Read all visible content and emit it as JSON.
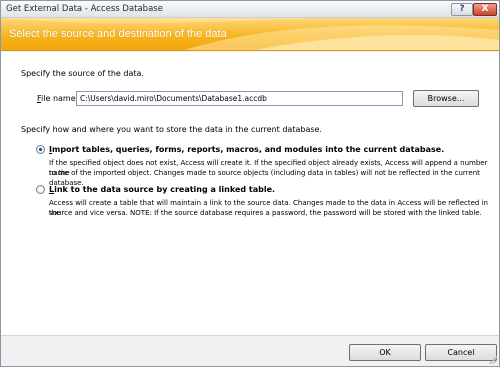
{
  "window": {
    "title": "Get External Data - Access Database",
    "help_glyph": "?",
    "close_glyph": "X"
  },
  "banner": {
    "heading": "Select the source and destination of the data"
  },
  "source": {
    "prompt": "Specify the source of the data.",
    "file_label_accel": "F",
    "file_label_rest": "ile name:",
    "file_value": "C:\\Users\\david.miro\\Documents\\Database1.accdb",
    "browse_label": "Browse..."
  },
  "storage": {
    "prompt": "Specify how and where you want to store the data in the current database.",
    "options": [
      {
        "accel": "I",
        "title_rest": "mport tables, queries, forms, reports, macros, and modules into the current database.",
        "selected": true,
        "desc_line1": "If the specified object does not exist, Access will create it. If the specified object already exists, Access will append a number to the",
        "desc_line2": "name of the imported object. Changes made to source objects (including data in tables) will not be reflected in the current database."
      },
      {
        "accel": "L",
        "title_rest": "ink to the data source by creating a linked table.",
        "selected": false,
        "desc_line1": "Access will create a table that will maintain a link to the source data. Changes made to the data in Access will be reflected in the",
        "desc_line2": "source and vice versa. NOTE:  If the source database requires a password, the password will be stored with the linked table."
      }
    ]
  },
  "footer": {
    "ok_label": "OK",
    "cancel_label": "Cancel"
  },
  "colors": {
    "banner": "#f6b21a",
    "radio_dot": "#1a3f8a"
  }
}
